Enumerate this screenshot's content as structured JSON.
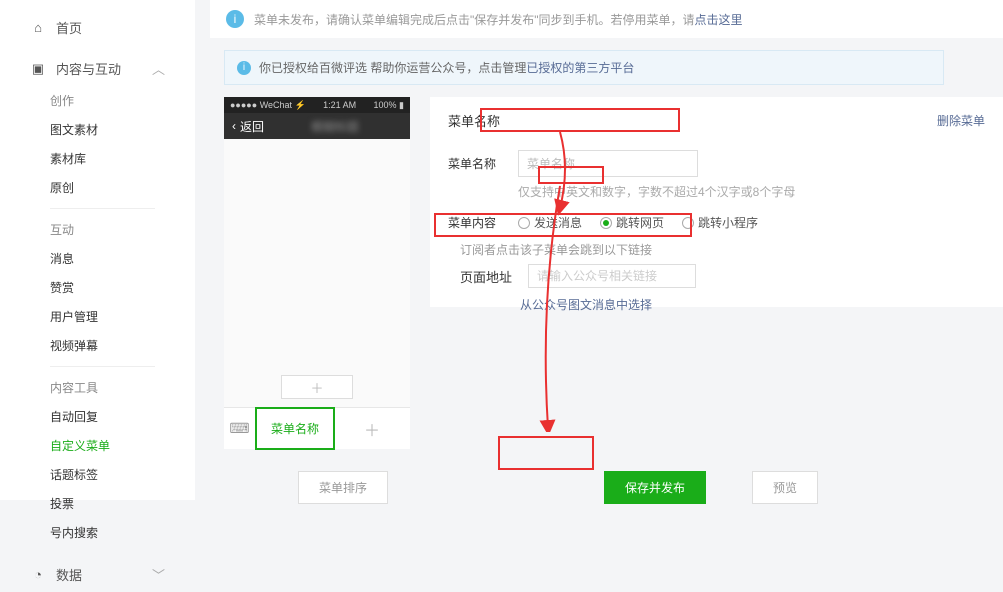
{
  "sidebar": {
    "home": "首页",
    "content_section": "内容与互动",
    "groups": {
      "g1_label": "创作",
      "g1_items": [
        "图文素材",
        "素材库",
        "原创"
      ],
      "g2_label": "互动",
      "g2_items": [
        "消息",
        "赞赏",
        "用户管理",
        "视频弹幕"
      ],
      "g3_label": "内容工具",
      "g3_items": [
        "自动回复",
        "自定义菜单",
        "话题标签",
        "投票",
        "号内搜索"
      ]
    },
    "data_section": "数据"
  },
  "notice": {
    "text_pre": "菜单未发布，请确认菜单编辑完成后点击\"保存并发布\"同步到手机。若停用菜单，请",
    "link": "点击这里"
  },
  "auth": {
    "text_pre": "你已授权给百微评选  帮助你运营公众号，点击管理",
    "link": "已授权的第三方平台"
  },
  "phone": {
    "carrier": "WeChat",
    "time": "1:21 AM",
    "battery": "100%",
    "back": "返回",
    "menu_slot_active": "菜单名称"
  },
  "form": {
    "title": "菜单名称",
    "delete": "删除菜单",
    "name_label": "菜单名称",
    "name_placeholder": "菜单名称",
    "name_hint": "仅支持中英文和数字，字数不超过4个汉字或8个字母",
    "content_label": "菜单内容",
    "radios": {
      "r1": "发送消息",
      "r2": "跳转网页",
      "r3": "跳转小程序"
    },
    "sub_hint": "订阅者点击该子菜单会跳到以下链接",
    "url_label": "页面地址",
    "url_placeholder": "请输入公众号相关链接",
    "select_link": "从公众号图文消息中选择"
  },
  "buttons": {
    "sort": "菜单排序",
    "save": "保存并发布",
    "preview": "预览"
  }
}
